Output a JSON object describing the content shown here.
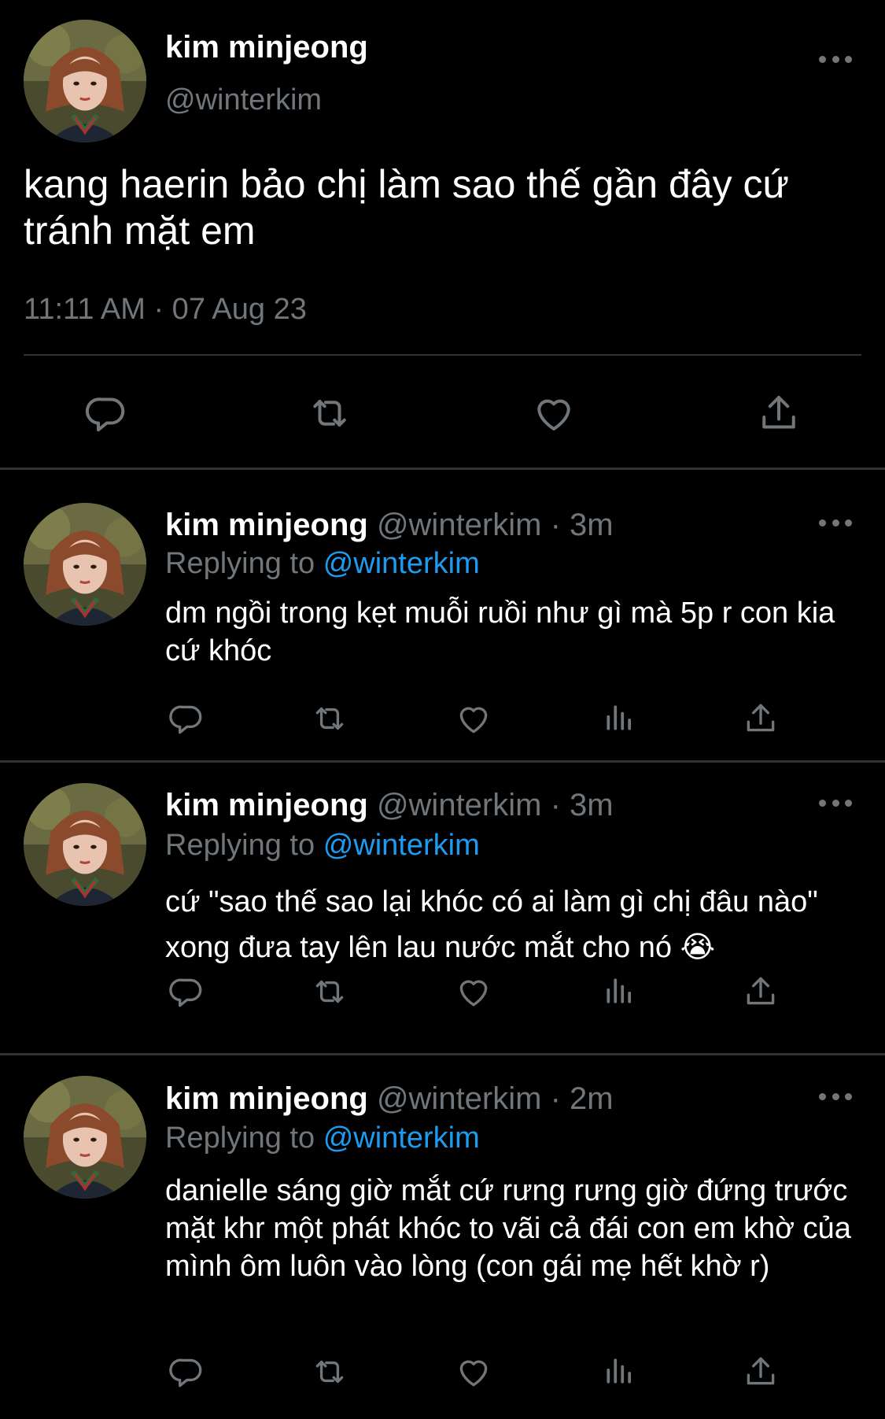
{
  "main_tweet": {
    "author_name": "kim minjeong",
    "author_handle": "@winterkim",
    "text": "kang haerin bảo chị làm sao thế gần đây cứ tránh mặt em",
    "timestamp": "11:11 AM · 07 Aug 23",
    "actions": [
      "reply-icon",
      "retweet-icon",
      "like-icon",
      "share-icon"
    ]
  },
  "replies": [
    {
      "name": "kim minjeong",
      "handle": "@winterkim",
      "time": "3m",
      "replying_label": "Replying to",
      "replying_to": "@winterkim",
      "text": "dm ngồi trong kẹt muỗi ruồi như gì mà 5p r con kia cứ khóc"
    },
    {
      "name": "kim minjeong",
      "handle": "@winterkim",
      "time": "3m",
      "replying_label": "Replying to",
      "replying_to": "@winterkim",
      "text": "cứ \"sao thế sao lại khóc có ai làm gì chị đâu nào\" xong đưa tay lên lau nước mắt cho nó 😭"
    },
    {
      "name": "kim minjeong",
      "handle": "@winterkim",
      "time": "2m",
      "replying_label": "Replying to",
      "replying_to": "@winterkim",
      "text": "danielle sáng giờ mắt cứ rưng rưng giờ đứng trước mặt khr một phát khóc to vãi cả đái con em khờ của mình ôm luôn vào lòng (con gái mẹ hết khờ r)"
    }
  ],
  "reply_actions": [
    "reply-icon",
    "retweet-icon",
    "like-icon",
    "analytics-icon",
    "share-icon"
  ],
  "separator": " · ",
  "colors": {
    "background": "#000000",
    "text": "#ffffff",
    "secondary": "#71767b",
    "link": "#1d9bf0",
    "divider": "#2f3336"
  }
}
